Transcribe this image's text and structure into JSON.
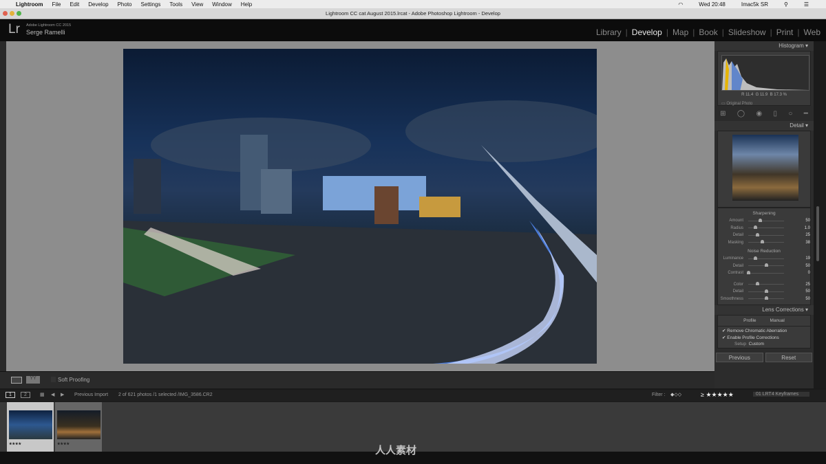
{
  "menubar": {
    "items": [
      "Lightroom",
      "File",
      "Edit",
      "Develop",
      "Photo",
      "Settings",
      "Tools",
      "View",
      "Window",
      "Help"
    ],
    "clock": "Wed 20:48",
    "user": "Imac5k SR"
  },
  "window": {
    "title": "Lightroom CC cat August 2015.lrcat - Adobe Photoshop Lightroom - Develop"
  },
  "identity": {
    "logo": "Lr",
    "product": "Adobe Lightroom CC 2015",
    "name": "Serge Ramelli"
  },
  "modules": [
    "Library",
    "Develop",
    "Map",
    "Book",
    "Slideshow",
    "Print",
    "Web"
  ],
  "active_module": "Develop",
  "histogram": {
    "title": "Histogram",
    "r": "R  11.4",
    "g": "G  11.9",
    "b": "B  17.3 %",
    "original": "Original Photo"
  },
  "detail": {
    "title": "Detail",
    "sharpening": {
      "title": "Sharpening",
      "sliders": [
        {
          "label": "Amount",
          "value": "50",
          "pos": 0.33
        },
        {
          "label": "Radius",
          "value": "1.0",
          "pos": 0.2
        },
        {
          "label": "Detail",
          "value": "25",
          "pos": 0.25
        },
        {
          "label": "Masking",
          "value": "38",
          "pos": 0.38
        }
      ]
    },
    "noise": {
      "title": "Noise Reduction",
      "sliders": [
        {
          "label": "Luminance",
          "value": "19",
          "pos": 0.19
        },
        {
          "label": "Detail",
          "value": "50",
          "pos": 0.5
        },
        {
          "label": "Contrast",
          "value": "0",
          "pos": 0
        },
        {
          "label": "Color",
          "value": "25",
          "pos": 0.25
        },
        {
          "label": "Detail",
          "value": "50",
          "pos": 0.5
        },
        {
          "label": "Smoothness",
          "value": "50",
          "pos": 0.5
        }
      ]
    }
  },
  "lens": {
    "title": "Lens Corrections",
    "tabs": [
      "Profile",
      "Manual"
    ],
    "remove_ca": "Remove Chromatic Aberration",
    "enable_profile": "Enable Profile Corrections",
    "setup_label": "Setup",
    "setup_value": "Custom"
  },
  "buttons": {
    "previous": "Previous",
    "reset": "Reset"
  },
  "toolbar": {
    "soft_proofing": "Soft Proofing"
  },
  "filmbar": {
    "page1": "1",
    "page2": "2",
    "source": "Previous Import",
    "info": "2 of 621 photos /1 selected /IMG_3586.CR2",
    "filter_label": "Filter :",
    "rating": "≥ ★★★★★",
    "rating_stars": 4,
    "collection": "01 LRT4 Keyframes"
  },
  "thumbnails": [
    {
      "stars": "★★★★",
      "selected": true
    },
    {
      "stars": "★★★★",
      "selected": false
    }
  ],
  "watermark": "人人素材"
}
